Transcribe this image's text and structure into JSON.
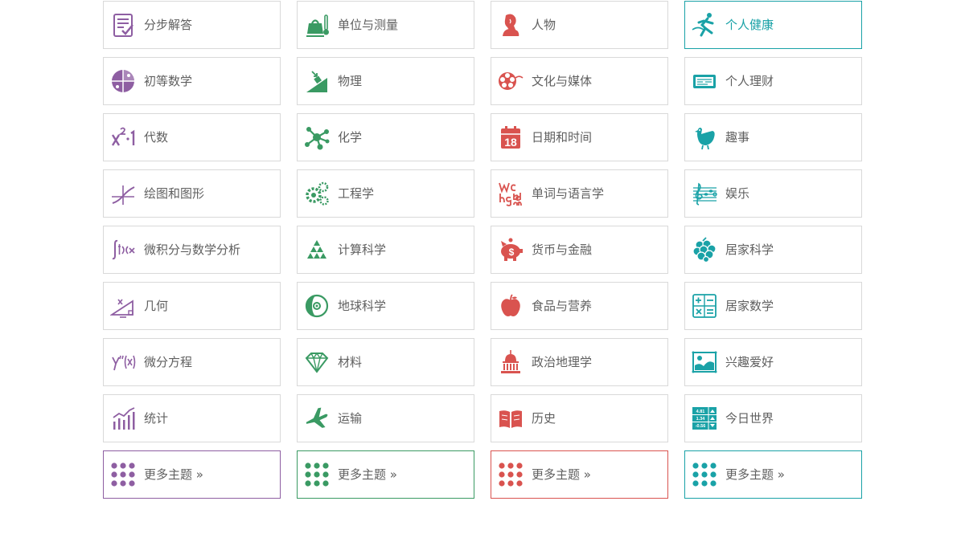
{
  "colors": {
    "math": "#8e5ea2",
    "science": "#3a9a63",
    "society": "#d9534f",
    "everyday": "#1aa2a7",
    "border": "#d9d9d9",
    "text": "#5f5f5f"
  },
  "columns": [
    {
      "name": "math",
      "items": [
        {
          "label": "分步解答",
          "icon": "step-by-step-icon"
        },
        {
          "label": "初等数学",
          "icon": "fraction-pie-icon"
        },
        {
          "label": "代数",
          "icon": "algebra-x-squared-icon"
        },
        {
          "label": "绘图和图形",
          "icon": "plot-curve-icon"
        },
        {
          "label": "微积分与数学分析",
          "icon": "integral-icon"
        },
        {
          "label": "几何",
          "icon": "right-triangle-icon"
        },
        {
          "label": "微分方程",
          "icon": "y-double-prime-icon"
        },
        {
          "label": "统计",
          "icon": "statistics-chart-icon"
        }
      ],
      "more_label": "更多主题 »"
    },
    {
      "name": "science",
      "items": [
        {
          "label": "单位与测量",
          "icon": "weight-thermometer-icon"
        },
        {
          "label": "物理",
          "icon": "physics-ramp-icon"
        },
        {
          "label": "化学",
          "icon": "molecule-icon"
        },
        {
          "label": "工程学",
          "icon": "gears-icon"
        },
        {
          "label": "计算科学",
          "icon": "triangle-pattern-icon"
        },
        {
          "label": "地球科学",
          "icon": "earth-globe-icon"
        },
        {
          "label": "材料",
          "icon": "diamond-icon"
        },
        {
          "label": "运输",
          "icon": "airplane-icon"
        }
      ],
      "more_label": "更多主题 »"
    },
    {
      "name": "society",
      "items": [
        {
          "label": "人物",
          "icon": "person-portrait-icon"
        },
        {
          "label": "文化与媒体",
          "icon": "film-reel-icon"
        },
        {
          "label": "日期和时间",
          "icon": "calendar-icon"
        },
        {
          "label": "单词与语言学",
          "icon": "letters-icon"
        },
        {
          "label": "货币与金融",
          "icon": "piggy-bank-icon"
        },
        {
          "label": "食品与营养",
          "icon": "apple-icon"
        },
        {
          "label": "政治地理学",
          "icon": "capitol-building-icon"
        },
        {
          "label": "历史",
          "icon": "open-book-icon"
        }
      ],
      "more_label": "更多主题 »",
      "calendar_day": "18"
    },
    {
      "name": "everyday",
      "items": [
        {
          "label": "个人健康",
          "icon": "runner-icon"
        },
        {
          "label": "个人理财",
          "icon": "check-card-icon"
        },
        {
          "label": "趣事",
          "icon": "chicken-icon"
        },
        {
          "label": "娱乐",
          "icon": "music-staff-icon"
        },
        {
          "label": "居家科学",
          "icon": "grapes-icon"
        },
        {
          "label": "居家数学",
          "icon": "calculator-icon"
        },
        {
          "label": "兴趣爱好",
          "icon": "picture-frame-icon"
        },
        {
          "label": "今日世界",
          "icon": "stock-ticker-icon"
        }
      ],
      "more_label": "更多主题 »",
      "ticker_values": [
        "4.81",
        "1.34",
        "-0.56"
      ]
    }
  ],
  "active_item": "个人健康"
}
